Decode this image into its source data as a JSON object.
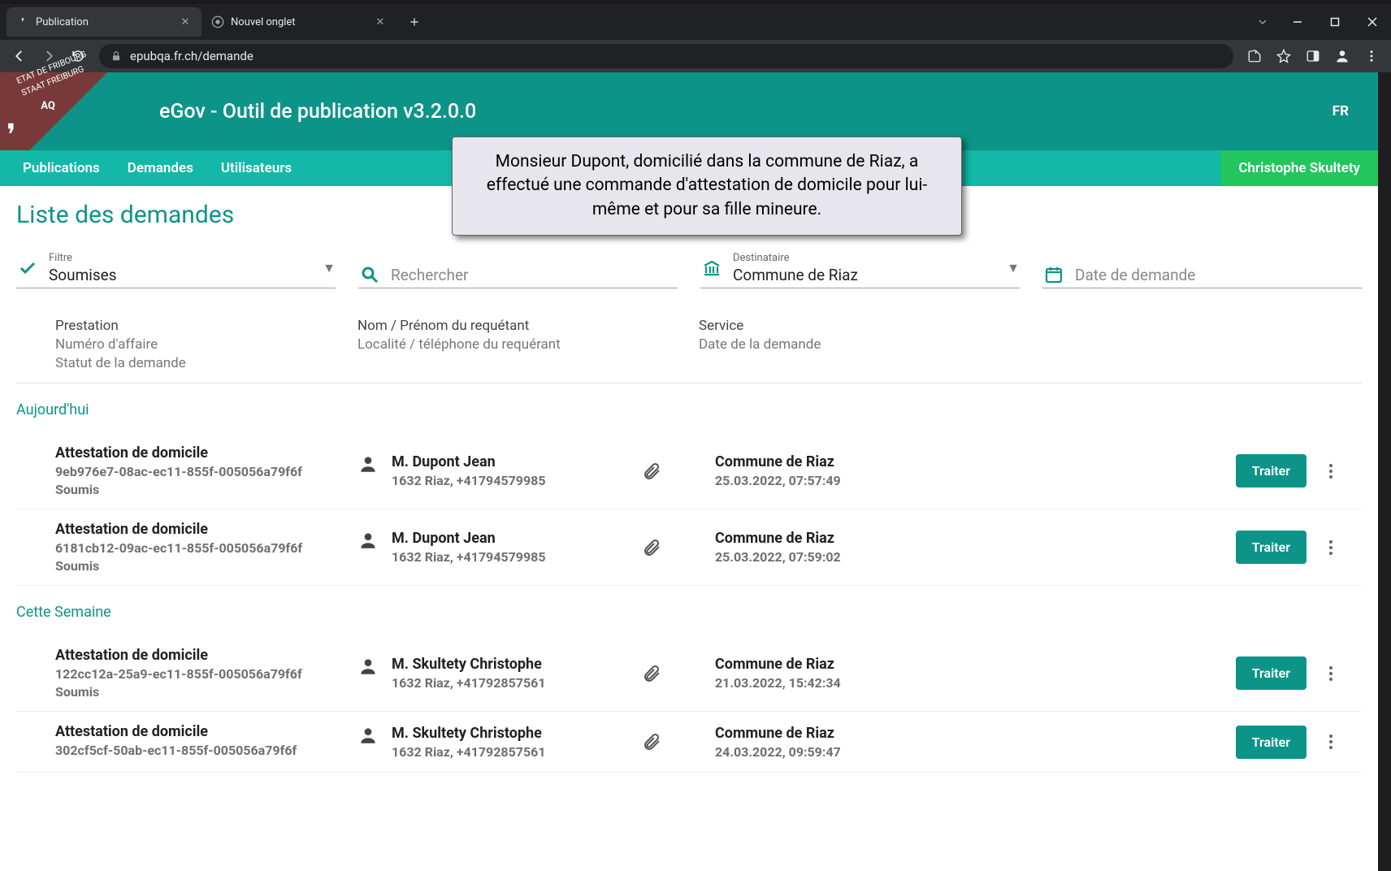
{
  "browser": {
    "tabs": [
      {
        "title": "Publication",
        "active": true
      },
      {
        "title": "Nouvel onglet",
        "active": false
      }
    ],
    "url": "epubqa.fr.ch/demande"
  },
  "header": {
    "ribbon_line1": "ETAT DE FRIBOURG",
    "ribbon_line2": "STAAT FREIBURG",
    "bubble": "AQ",
    "title": "eGov - Outil de publication v3.2.0.0",
    "lang": "FR"
  },
  "nav": {
    "items": [
      "Publications",
      "Demandes",
      "Utilisateurs"
    ],
    "user": "Christophe Skultety"
  },
  "callout": "Monsieur Dupont, domicilié dans la commune de Riaz, a effectué une commande d'attestation de domicile pour lui-même et pour sa fille mineure.",
  "page_title": "Liste des demandes",
  "filters": {
    "filtre": {
      "label": "Filtre",
      "value": "Soumises"
    },
    "search": {
      "placeholder": "Rechercher"
    },
    "destinataire": {
      "label": "Destinataire",
      "value": "Commune de Riaz"
    },
    "date": {
      "placeholder": "Date de demande"
    }
  },
  "columns": {
    "a1": "Prestation",
    "a2": "Numéro d'affaire",
    "a3": "Statut de la demande",
    "b1": "Nom / Prénom du requétant",
    "b2": "Localité / téléphone du requérant",
    "c1": "Service",
    "c2": "Date de la demande"
  },
  "groups": {
    "today": "Aujourd'hui",
    "week": "Cette Semaine"
  },
  "action_label": "Traiter",
  "requests_today": [
    {
      "prestation": "Attestation de domicile",
      "affaire": "9eb976e7-08ac-ec11-855f-005056a79f6f",
      "statut": "Soumis",
      "nom": "M. Dupont Jean",
      "loc": "1632 Riaz, +41794579985",
      "service": "Commune de Riaz",
      "date": "25.03.2022, 07:57:49"
    },
    {
      "prestation": "Attestation de domicile",
      "affaire": "6181cb12-09ac-ec11-855f-005056a79f6f",
      "statut": "Soumis",
      "nom": "M. Dupont Jean",
      "loc": "1632 Riaz, +41794579985",
      "service": "Commune de Riaz",
      "date": "25.03.2022, 07:59:02"
    }
  ],
  "requests_week": [
    {
      "prestation": "Attestation de domicile",
      "affaire": "122cc12a-25a9-ec11-855f-005056a79f6f",
      "statut": "Soumis",
      "nom": "M. Skultety Christophe",
      "loc": "1632 Riaz, +41792857561",
      "service": "Commune de Riaz",
      "date": "21.03.2022, 15:42:34"
    },
    {
      "prestation": "Attestation de domicile",
      "affaire": "302cf5cf-50ab-ec11-855f-005056a79f6f",
      "statut": "",
      "nom": "M. Skultety Christophe",
      "loc": "1632 Riaz, +41792857561",
      "service": "Commune de Riaz",
      "date": "24.03.2022, 09:59:47"
    }
  ]
}
